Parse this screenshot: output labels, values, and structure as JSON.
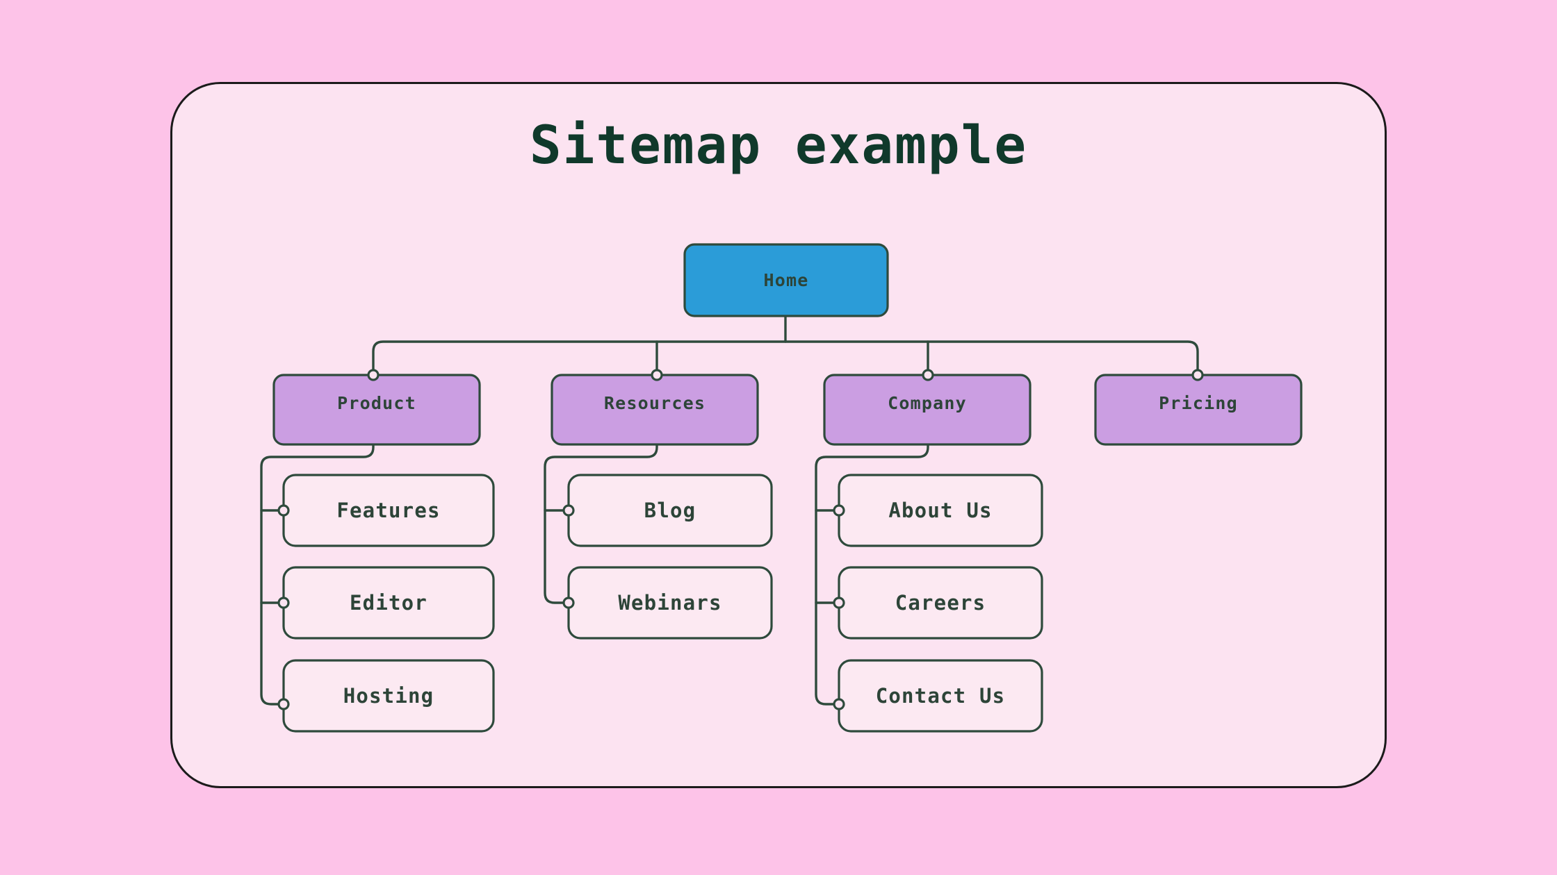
{
  "page": {
    "background_color": "#fdc3e8",
    "card_background": "#fce3f1",
    "card_border_color": "#1b1b1b"
  },
  "title": "Sitemap example",
  "colors": {
    "root_fill": "#2b9cd8",
    "section_fill": "#cb9ee2",
    "leaf_fill": "#fce9f2",
    "node_stroke": "#2e4a3c",
    "edge_stroke": "#2e4a3c",
    "text": "#2d4438",
    "title_text": "#10392b"
  },
  "chart_data": {
    "type": "diagram",
    "diagram_kind": "sitemap-tree",
    "title": "Sitemap example",
    "root": "Home",
    "levels": 3,
    "nodes": [
      {
        "id": "home",
        "label": "Home",
        "level": 0,
        "parent": null,
        "kind": "root"
      },
      {
        "id": "product",
        "label": "Product",
        "level": 1,
        "parent": "home",
        "kind": "section"
      },
      {
        "id": "resources",
        "label": "Resources",
        "level": 1,
        "parent": "home",
        "kind": "section"
      },
      {
        "id": "company",
        "label": "Company",
        "level": 1,
        "parent": "home",
        "kind": "section"
      },
      {
        "id": "pricing",
        "label": "Pricing",
        "level": 1,
        "parent": "home",
        "kind": "section"
      },
      {
        "id": "features",
        "label": "Features",
        "level": 2,
        "parent": "product",
        "kind": "leaf"
      },
      {
        "id": "editor",
        "label": "Editor",
        "level": 2,
        "parent": "product",
        "kind": "leaf"
      },
      {
        "id": "hosting",
        "label": "Hosting",
        "level": 2,
        "parent": "product",
        "kind": "leaf"
      },
      {
        "id": "blog",
        "label": "Blog",
        "level": 2,
        "parent": "resources",
        "kind": "leaf"
      },
      {
        "id": "webinars",
        "label": "Webinars",
        "level": 2,
        "parent": "resources",
        "kind": "leaf"
      },
      {
        "id": "about-us",
        "label": "About Us",
        "level": 2,
        "parent": "company",
        "kind": "leaf"
      },
      {
        "id": "careers",
        "label": "Careers",
        "level": 2,
        "parent": "company",
        "kind": "leaf"
      },
      {
        "id": "contact-us",
        "label": "Contact Us",
        "level": 2,
        "parent": "company",
        "kind": "leaf"
      }
    ],
    "edges": [
      {
        "from": "home",
        "to": "product"
      },
      {
        "from": "home",
        "to": "resources"
      },
      {
        "from": "home",
        "to": "company"
      },
      {
        "from": "home",
        "to": "pricing"
      },
      {
        "from": "product",
        "to": "features"
      },
      {
        "from": "product",
        "to": "editor"
      },
      {
        "from": "product",
        "to": "hosting"
      },
      {
        "from": "resources",
        "to": "blog"
      },
      {
        "from": "resources",
        "to": "webinars"
      },
      {
        "from": "company",
        "to": "about-us"
      },
      {
        "from": "company",
        "to": "careers"
      },
      {
        "from": "company",
        "to": "contact-us"
      }
    ]
  },
  "nodes": {
    "home": "Home",
    "product": "Product",
    "resources": "Resources",
    "company": "Company",
    "pricing": "Pricing",
    "features": "Features",
    "editor": "Editor",
    "hosting": "Hosting",
    "blog": "Blog",
    "webinars": "Webinars",
    "about_us": "About Us",
    "careers": "Careers",
    "contact_us": "Contact Us"
  }
}
